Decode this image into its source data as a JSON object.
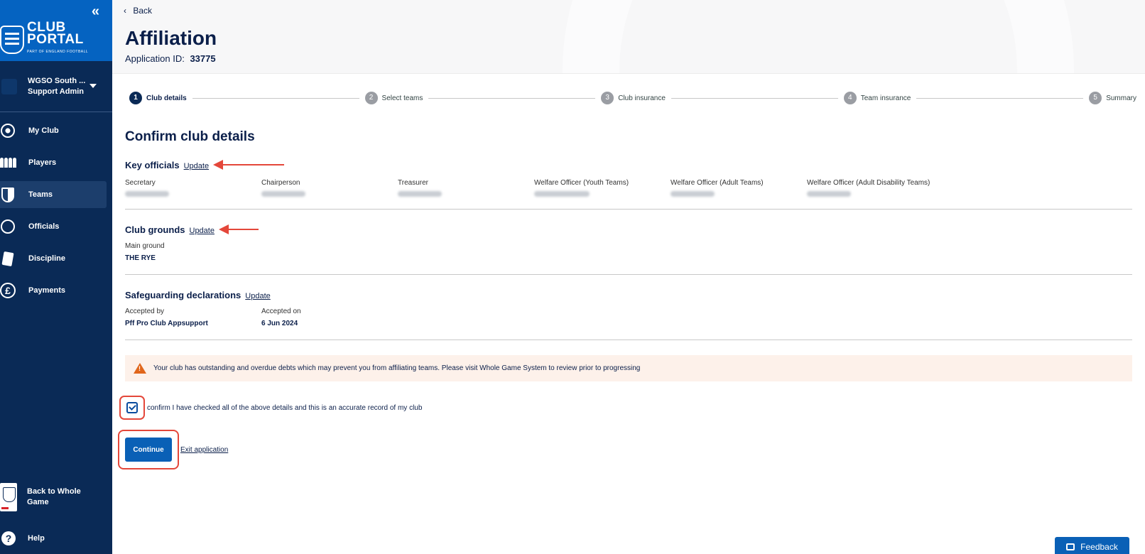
{
  "sidebar": {
    "logo": {
      "line1": "CLUB",
      "line2": "PORTAL",
      "line3": "PART OF ENGLAND FOOTBALL"
    },
    "account": {
      "name": "WGSO South ...",
      "role": "Support Admin"
    },
    "items": [
      {
        "label": "My Club",
        "icon": "football-icon"
      },
      {
        "label": "Players",
        "icon": "players-icon"
      },
      {
        "label": "Teams",
        "icon": "shield-icon",
        "active": true
      },
      {
        "label": "Officials",
        "icon": "officials-icon"
      },
      {
        "label": "Discipline",
        "icon": "card-icon"
      },
      {
        "label": "Payments",
        "icon": "pound-icon"
      }
    ],
    "back_to_whole_game": {
      "line1": "Back to Whole",
      "line2": "Game"
    },
    "help": {
      "label": "Help",
      "icon_glyph": "?"
    }
  },
  "header": {
    "back_label": "Back",
    "title": "Affiliation",
    "app_id_label": "Application ID:",
    "app_id_value": "33775"
  },
  "stepper": {
    "steps": [
      {
        "num": "1",
        "label": "Club details",
        "active": true
      },
      {
        "num": "2",
        "label": "Select teams"
      },
      {
        "num": "3",
        "label": "Club insurance"
      },
      {
        "num": "4",
        "label": "Team insurance"
      },
      {
        "num": "5",
        "label": "Summary"
      }
    ]
  },
  "content": {
    "title": "Confirm club details",
    "update_label": "Update",
    "key_officials": {
      "title": "Key officials",
      "roles": [
        "Secretary",
        "Chairperson",
        "Treasurer",
        "Welfare Officer (Youth Teams)",
        "Welfare Officer (Adult Teams)",
        "Welfare Officer (Adult Disability Teams)"
      ]
    },
    "club_grounds": {
      "title": "Club grounds",
      "main_ground_label": "Main ground",
      "main_ground_value": "THE RYE"
    },
    "safeguarding": {
      "title": "Safeguarding declarations",
      "accepted_by_label": "Accepted by",
      "accepted_by_value": "Pff Pro Club Appsupport",
      "accepted_on_label": "Accepted on",
      "accepted_on_value": "6 Jun 2024"
    },
    "warning_text": "Your club has outstanding and overdue debts which may prevent you from affiliating teams. Please visit Whole Game System to review prior to progressing",
    "confirm_text": "confirm I have checked all of the above details and this is an accurate record of my club",
    "confirm_checked": true,
    "continue_label": "Continue",
    "exit_label": "Exit application"
  },
  "feedback_label": "Feedback",
  "colors": {
    "sidebar": "#0a2a56",
    "logo_bg": "#0563c1",
    "primary": "#0a60b6",
    "annotation": "#e4473a",
    "warning_bg": "#fdf1ea",
    "warning_icon": "#e0661b"
  }
}
